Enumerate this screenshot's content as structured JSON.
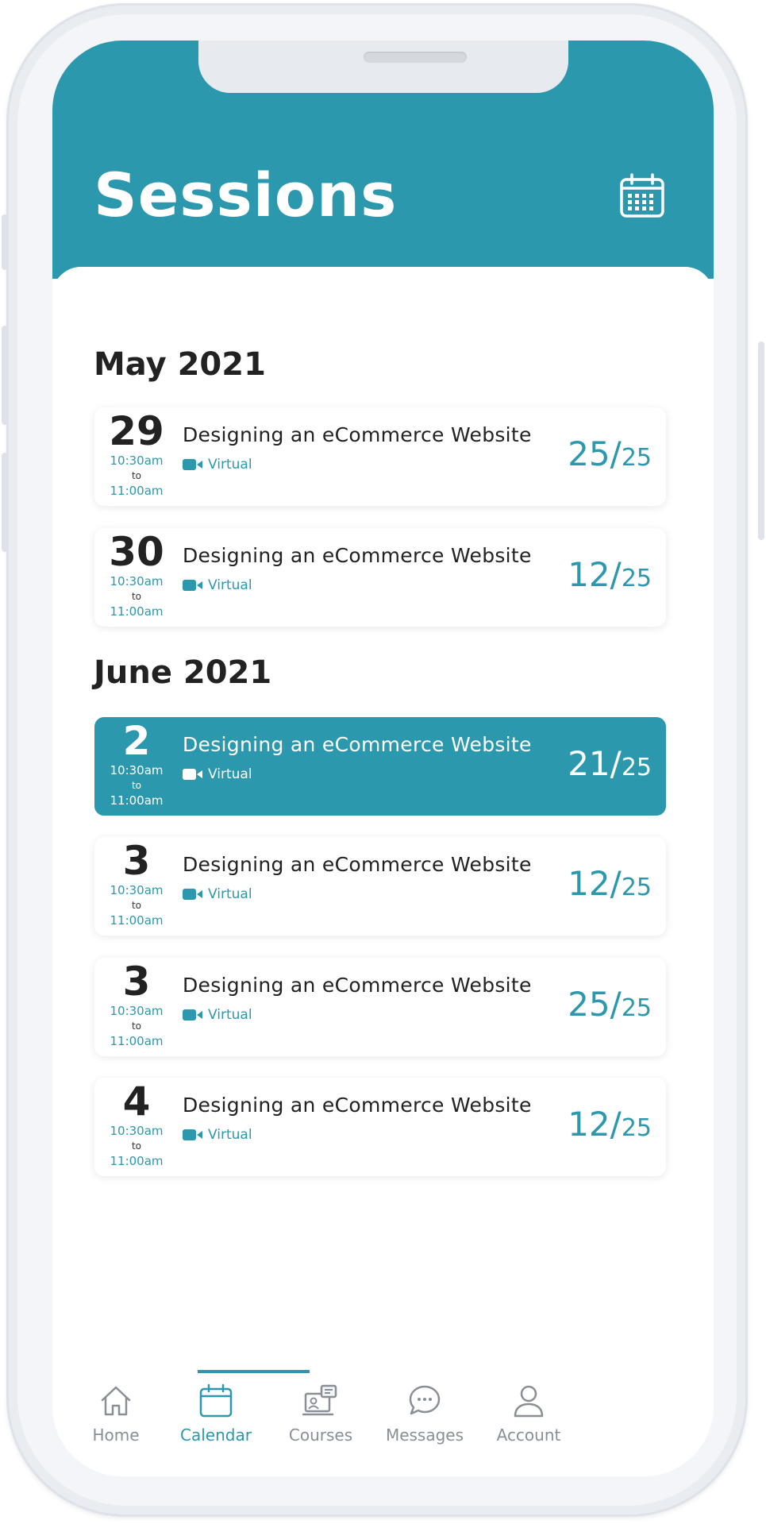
{
  "header": {
    "title": "Sessions"
  },
  "groups": [
    {
      "month": "May 2021",
      "sessions": [
        {
          "day": "29",
          "start": "10:30am",
          "to": "to",
          "end": "11:00am",
          "title": "Designing an eCommerce Website",
          "mode": "Virtual",
          "count": "25",
          "capacity": "25"
        },
        {
          "day": "30",
          "start": "10:30am",
          "to": "to",
          "end": "11:00am",
          "title": "Designing an eCommerce Website",
          "mode": "Virtual",
          "count": "12",
          "capacity": "25"
        }
      ]
    },
    {
      "month": "June 2021",
      "sessions": [
        {
          "day": "2",
          "start": "10:30am",
          "to": "to",
          "end": "11:00am",
          "title": "Designing an eCommerce Website",
          "mode": "Virtual",
          "count": "21",
          "capacity": "25"
        },
        {
          "day": "3",
          "start": "10:30am",
          "to": "to",
          "end": "11:00am",
          "title": "Designing an eCommerce Website",
          "mode": "Virtual",
          "count": "12",
          "capacity": "25"
        },
        {
          "day": "3",
          "start": "10:30am",
          "to": "to",
          "end": "11:00am",
          "title": "Designing an eCommerce Website",
          "mode": "Virtual",
          "count": "25",
          "capacity": "25"
        },
        {
          "day": "4",
          "start": "10:30am",
          "to": "to",
          "end": "11:00am",
          "title": "Designing an eCommerce Website",
          "mode": "Virtual",
          "count": "12",
          "capacity": "25"
        }
      ]
    }
  ],
  "nav": [
    {
      "label": "Home",
      "icon": "home-icon"
    },
    {
      "label": "Calendar",
      "icon": "calendar-icon"
    },
    {
      "label": "Courses",
      "icon": "courses-icon"
    },
    {
      "label": "Messages",
      "icon": "messages-icon"
    },
    {
      "label": "Account",
      "icon": "account-icon"
    }
  ],
  "theme": {
    "accent": "#2b98ad",
    "text": "#222222",
    "muted": "#8a8f95"
  }
}
